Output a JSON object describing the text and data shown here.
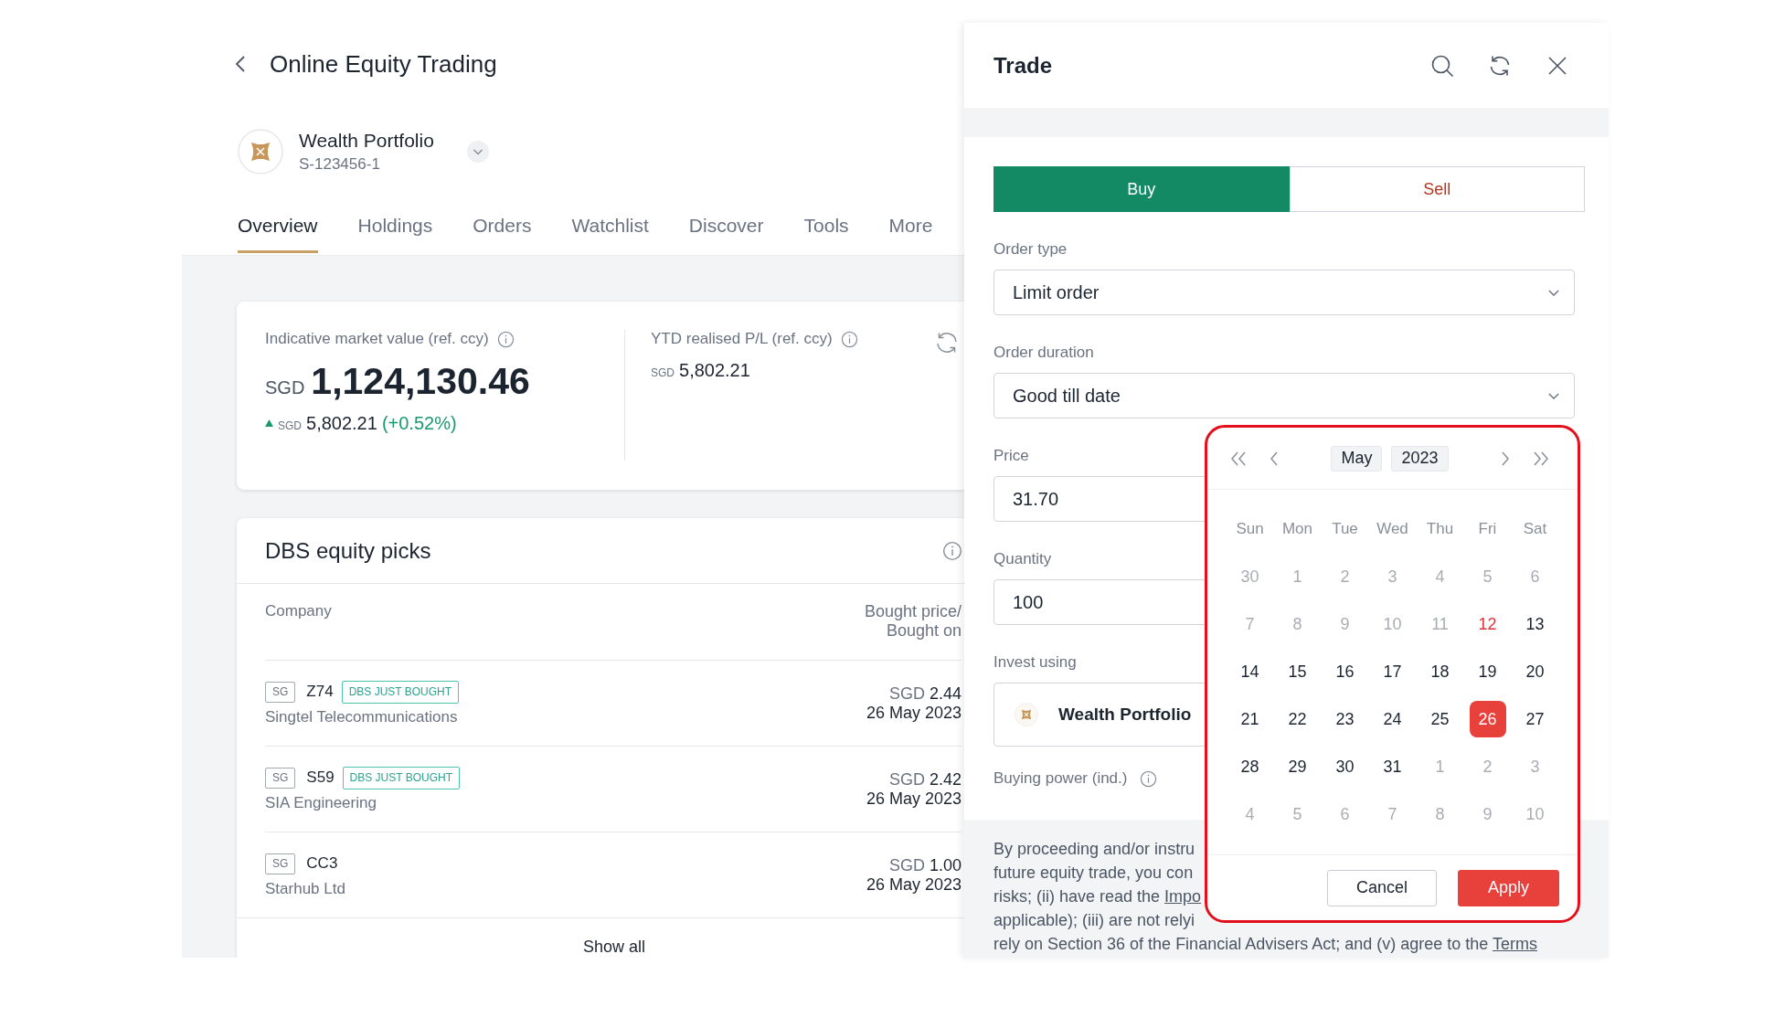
{
  "page": {
    "title": "Online Equity Trading"
  },
  "portfolio": {
    "name": "Wealth Portfolio",
    "account": "S-123456-1"
  },
  "tabs": [
    {
      "label": "Overview",
      "selected": true
    },
    {
      "label": "Holdings",
      "selected": false
    },
    {
      "label": "Orders",
      "selected": false
    },
    {
      "label": "Watchlist",
      "selected": false
    },
    {
      "label": "Discover",
      "selected": false
    },
    {
      "label": "Tools",
      "selected": false
    },
    {
      "label": "More",
      "selected": false
    }
  ],
  "summary": {
    "market_value": {
      "label": "Indicative market value (ref. ccy)",
      "currency": "SGD",
      "amount": "1,124,130.46",
      "change": {
        "positive": true,
        "currency": "SGD",
        "amount": "5,802.21",
        "percent": "(+0.52%)"
      }
    },
    "realised_pl": {
      "label": "YTD realised P/L (ref. ccy)",
      "currency": "SGD",
      "amount": "5,802.21"
    }
  },
  "picks": {
    "title": "DBS equity picks",
    "columns": [
      "Company",
      "Bought price/\nBought on"
    ],
    "rows": [
      {
        "market": "SG",
        "ticker": "Z74",
        "tag": "DBS JUST BOUGHT",
        "name": "Singtel Telecommunications",
        "currency": "SGD",
        "price": "2.44",
        "date": "26 May 2023"
      },
      {
        "market": "SG",
        "ticker": "S59",
        "tag": "DBS JUST BOUGHT",
        "name": "SIA Engineering",
        "currency": "SGD",
        "price": "2.42",
        "date": "26 May 2023"
      },
      {
        "market": "SG",
        "ticker": "CC3",
        "name": "Starhub Ltd",
        "currency": "SGD",
        "price": "1.00",
        "date": "26 May 2023"
      }
    ],
    "show_all": "Show all"
  },
  "trade": {
    "title": "Trade",
    "sides": [
      {
        "label": "Buy",
        "kind": "buy",
        "selected": true
      },
      {
        "label": "Sell",
        "kind": "sell",
        "selected": false
      }
    ],
    "fields": [
      {
        "kind": "select",
        "label": "Order type",
        "value": "Limit order"
      },
      {
        "kind": "select",
        "label": "Order duration",
        "value": "Good till date"
      },
      {
        "kind": "input",
        "label": "Price",
        "value": "31.70"
      },
      {
        "kind": "input",
        "label": "Quantity",
        "value": "100"
      },
      {
        "kind": "account",
        "label": "Invest using",
        "value": "Wealth Portfolio"
      }
    ],
    "buying_power": {
      "label": "Buying power (ind.)"
    },
    "disclaimer_lines": [
      {
        "text": "By proceeding and/or instru"
      },
      {
        "text": "future equity trade, you con"
      },
      {
        "text": "risks; (ii) have read the",
        "link": "Impo"
      },
      {
        "text": "applicable); (iii) are not relyi"
      },
      {
        "text": "rely on Section 36 of the Financial Advisers Act; and (v) agree to the",
        "link": "Terms"
      }
    ]
  },
  "date_picker": {
    "month": "May",
    "year": "2023",
    "weekdays": [
      "Sun",
      "Mon",
      "Tue",
      "Wed",
      "Thu",
      "Fri",
      "Sat"
    ],
    "weeks": [
      [
        {
          "day": "30",
          "disabled": true,
          "today": false,
          "selected": false
        },
        {
          "day": "1",
          "disabled": true,
          "today": false,
          "selected": false
        },
        {
          "day": "2",
          "disabled": true,
          "today": false,
          "selected": false
        },
        {
          "day": "3",
          "disabled": true,
          "today": false,
          "selected": false
        },
        {
          "day": "4",
          "disabled": true,
          "today": false,
          "selected": false
        },
        {
          "day": "5",
          "disabled": true,
          "today": false,
          "selected": false
        },
        {
          "day": "6",
          "disabled": true,
          "today": false,
          "selected": false
        }
      ],
      [
        {
          "day": "7",
          "disabled": true,
          "today": false,
          "selected": false
        },
        {
          "day": "8",
          "disabled": true,
          "today": false,
          "selected": false
        },
        {
          "day": "9",
          "disabled": true,
          "today": false,
          "selected": false
        },
        {
          "day": "10",
          "disabled": true,
          "today": false,
          "selected": false
        },
        {
          "day": "11",
          "disabled": true,
          "today": false,
          "selected": false
        },
        {
          "day": "12",
          "disabled": false,
          "today": true,
          "selected": false
        },
        {
          "day": "13",
          "disabled": false,
          "today": false,
          "selected": false
        }
      ],
      [
        {
          "day": "14",
          "disabled": false,
          "today": false,
          "selected": false
        },
        {
          "day": "15",
          "disabled": false,
          "today": false,
          "selected": false
        },
        {
          "day": "16",
          "disabled": false,
          "today": false,
          "selected": false
        },
        {
          "day": "17",
          "disabled": false,
          "today": false,
          "selected": false
        },
        {
          "day": "18",
          "disabled": false,
          "today": false,
          "selected": false
        },
        {
          "day": "19",
          "disabled": false,
          "today": false,
          "selected": false
        },
        {
          "day": "20",
          "disabled": false,
          "today": false,
          "selected": false
        }
      ],
      [
        {
          "day": "21",
          "disabled": false,
          "today": false,
          "selected": false
        },
        {
          "day": "22",
          "disabled": false,
          "today": false,
          "selected": false
        },
        {
          "day": "23",
          "disabled": false,
          "today": false,
          "selected": false
        },
        {
          "day": "24",
          "disabled": false,
          "today": false,
          "selected": false
        },
        {
          "day": "25",
          "disabled": false,
          "today": false,
          "selected": false
        },
        {
          "day": "26",
          "disabled": false,
          "today": false,
          "selected": true
        },
        {
          "day": "27",
          "disabled": false,
          "today": false,
          "selected": false
        }
      ],
      [
        {
          "day": "28",
          "disabled": false,
          "today": false,
          "selected": false
        },
        {
          "day": "29",
          "disabled": false,
          "today": false,
          "selected": false
        },
        {
          "day": "30",
          "disabled": false,
          "today": false,
          "selected": false
        },
        {
          "day": "31",
          "disabled": false,
          "today": false,
          "selected": false
        },
        {
          "day": "1",
          "disabled": true,
          "today": false,
          "selected": false
        },
        {
          "day": "2",
          "disabled": true,
          "today": false,
          "selected": false
        },
        {
          "day": "3",
          "disabled": true,
          "today": false,
          "selected": false
        }
      ],
      [
        {
          "day": "4",
          "disabled": true,
          "today": false,
          "selected": false
        },
        {
          "day": "5",
          "disabled": true,
          "today": false,
          "selected": false
        },
        {
          "day": "6",
          "disabled": true,
          "today": false,
          "selected": false
        },
        {
          "day": "7",
          "disabled": true,
          "today": false,
          "selected": false
        },
        {
          "day": "8",
          "disabled": true,
          "today": false,
          "selected": false
        },
        {
          "day": "9",
          "disabled": true,
          "today": false,
          "selected": false
        },
        {
          "day": "10",
          "disabled": true,
          "today": false,
          "selected": false
        }
      ]
    ],
    "buttons": [
      {
        "label": "Cancel",
        "kind": "secondary"
      },
      {
        "label": "Apply",
        "kind": "primary"
      }
    ]
  }
}
